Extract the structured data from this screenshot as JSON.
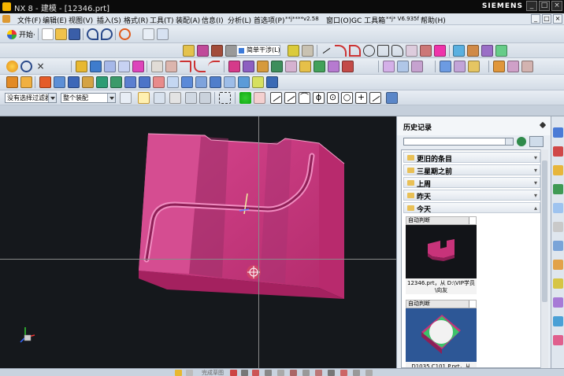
{
  "window": {
    "title": "NX 8 - 建模 - [12346.prt]",
    "brand": "SIEMENS",
    "buttons": [
      "_",
      "□",
      "×"
    ]
  },
  "menu": {
    "items": [
      "文件(F)",
      "编辑(E)",
      "视图(V)",
      "插入(S)",
      "格式(R)",
      "工具(T)",
      "装配(A)",
      "信息(I)",
      "分析(L)",
      "首选项(P)",
      "**j****v2.58",
      "窗口(O)",
      "GC 工具箱",
      "**j* V6.935f",
      "帮助(H)"
    ],
    "right_buttons": [
      "_",
      "□",
      "×"
    ]
  },
  "toolbar": {
    "start_label": "开始·",
    "simple_label": "简单干涉(L)..."
  },
  "filters": {
    "selection_filter": "没有选择过滤器",
    "assembly_scope": "整个装配"
  },
  "history_panel": {
    "title": "历史记录",
    "groups": [
      "更旧的条目",
      "三星期之前",
      "上周",
      "昨天",
      "今天"
    ],
    "entries": [
      {
        "tag": "自动判断",
        "name": "12346.prt，从 D:\\VIP学员\\向友"
      },
      {
        "tag": "自动判断",
        "name": "D1035.C101.P.prt，从"
      }
    ]
  },
  "statusbar": {
    "hint": "完成草图"
  },
  "colors": {
    "viewport_bg": "#15181c",
    "part_color": "#c8337a",
    "titlebar_bg": "#0b0b0b",
    "menu_bg": "#dfe6ee"
  }
}
